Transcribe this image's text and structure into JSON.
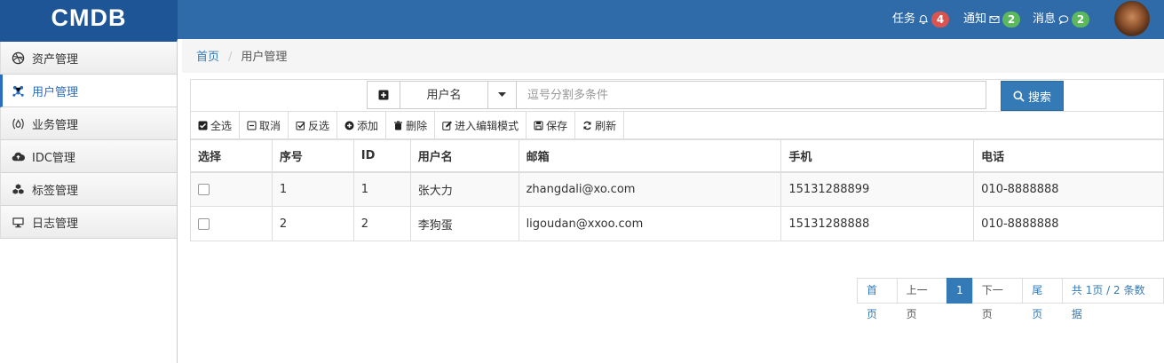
{
  "header": {
    "logo": "CMDB",
    "tasks": {
      "label": "任务",
      "count": "4"
    },
    "notices": {
      "label": "通知",
      "count": "2"
    },
    "messages": {
      "label": "消息",
      "count": "2"
    }
  },
  "sidebar": {
    "items": [
      {
        "label": "资产管理",
        "icon": "dribbble-icon"
      },
      {
        "label": "用户管理",
        "icon": "users-network-icon",
        "active": true
      },
      {
        "label": "业务管理",
        "icon": "fire-icon"
      },
      {
        "label": "IDC管理",
        "icon": "cloud-upload-icon"
      },
      {
        "label": "标签管理",
        "icon": "cubes-icon"
      },
      {
        "label": "日志管理",
        "icon": "desktop-icon"
      }
    ]
  },
  "breadcrumb": {
    "home": "首页",
    "current": "用户管理"
  },
  "search": {
    "field": "用户名",
    "placeholder": "逗号分割多条件",
    "button": "搜索"
  },
  "toolbar": {
    "select_all": "全选",
    "cancel": "取消",
    "invert": "反选",
    "add": "添加",
    "delete": "删除",
    "edit_mode": "进入编辑模式",
    "save": "保存",
    "refresh": "刷新"
  },
  "table": {
    "columns": [
      "选择",
      "序号",
      "ID",
      "用户名",
      "邮箱",
      "手机",
      "电话"
    ],
    "rows": [
      {
        "seq": "1",
        "id": "1",
        "username": "张大力",
        "email": "zhangdali@xo.com",
        "mobile": "15131288899",
        "phone": "010-8888888"
      },
      {
        "seq": "2",
        "id": "2",
        "username": "李狗蛋",
        "email": "ligoudan@xxoo.com",
        "mobile": "15131288888",
        "phone": "010-8888888"
      }
    ]
  },
  "pagination": {
    "first": "首页",
    "prev": "上一页",
    "current": "1",
    "next": "下一页",
    "last": "尾页",
    "summary": "共 1页 / 2 条数据"
  },
  "colors": {
    "header": "#2f6ba8",
    "logo_bg": "#1e5597",
    "primary": "#337ab7"
  }
}
